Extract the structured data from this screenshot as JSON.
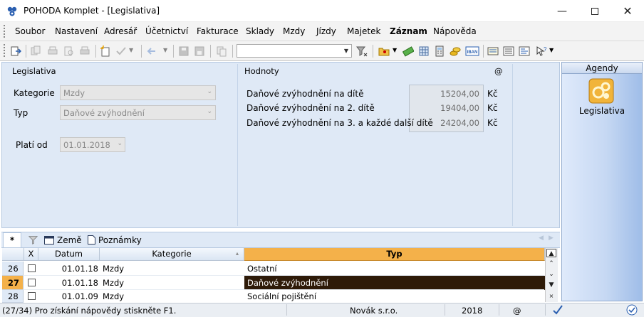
{
  "window": {
    "title": "POHODA Komplet - [Legislativa]"
  },
  "menu": [
    "Soubor",
    "Nastavení",
    "Adresář",
    "Účetnictví",
    "Fakturace",
    "Sklady",
    "Mzdy",
    "Jízdy",
    "Majetek",
    "Záznam",
    "Nápověda"
  ],
  "form": {
    "left_title": "Legislativa",
    "kategorie_label": "Kategorie",
    "kategorie_value": "Mzdy",
    "typ_label": "Typ",
    "typ_value": "Daňové zvýhodnění",
    "plati_od_label": "Platí od",
    "plati_od_value": "01.01.2018",
    "right_title": "Hodnoty",
    "at_sign": "@",
    "values": [
      {
        "label": "Daňové zvýhodnění na dítě",
        "amount": "15204,00",
        "currency": "Kč"
      },
      {
        "label": "Daňové zvýhodnění na 2. dítě",
        "amount": "19404,00",
        "currency": "Kč"
      },
      {
        "label": "Daňové zvýhodnění na 3. a každé další dítě",
        "amount": "24204,00",
        "currency": "Kč"
      }
    ]
  },
  "agendy": {
    "header": "Agendy",
    "item_label": "Legislativa"
  },
  "tabs": {
    "star": "*",
    "zeme": "Země",
    "poznamky": "Poznámky"
  },
  "grid": {
    "headers": {
      "x": "X",
      "datum": "Datum",
      "kategorie": "Kategorie",
      "typ": "Typ"
    },
    "rows": [
      {
        "num": "26",
        "datum": "01.01.18",
        "kategorie": "Mzdy",
        "typ": "Ostatní",
        "active": false
      },
      {
        "num": "27",
        "datum": "01.01.18",
        "kategorie": "Mzdy",
        "typ": "Daňové zvýhodnění",
        "active": true
      },
      {
        "num": "28",
        "datum": "01.01.09",
        "kategorie": "Mzdy",
        "typ": "Sociální pojištění",
        "active": false
      }
    ]
  },
  "status": {
    "message": "(27/34) Pro získání nápovědy stiskněte F1.",
    "company": "Novák s.r.o.",
    "year": "2018",
    "at_sign": "@"
  },
  "colors": {
    "selected_header": "#f4b14a",
    "selected_cell": "#2e1a08",
    "form_bg": "#dfe9f6"
  }
}
